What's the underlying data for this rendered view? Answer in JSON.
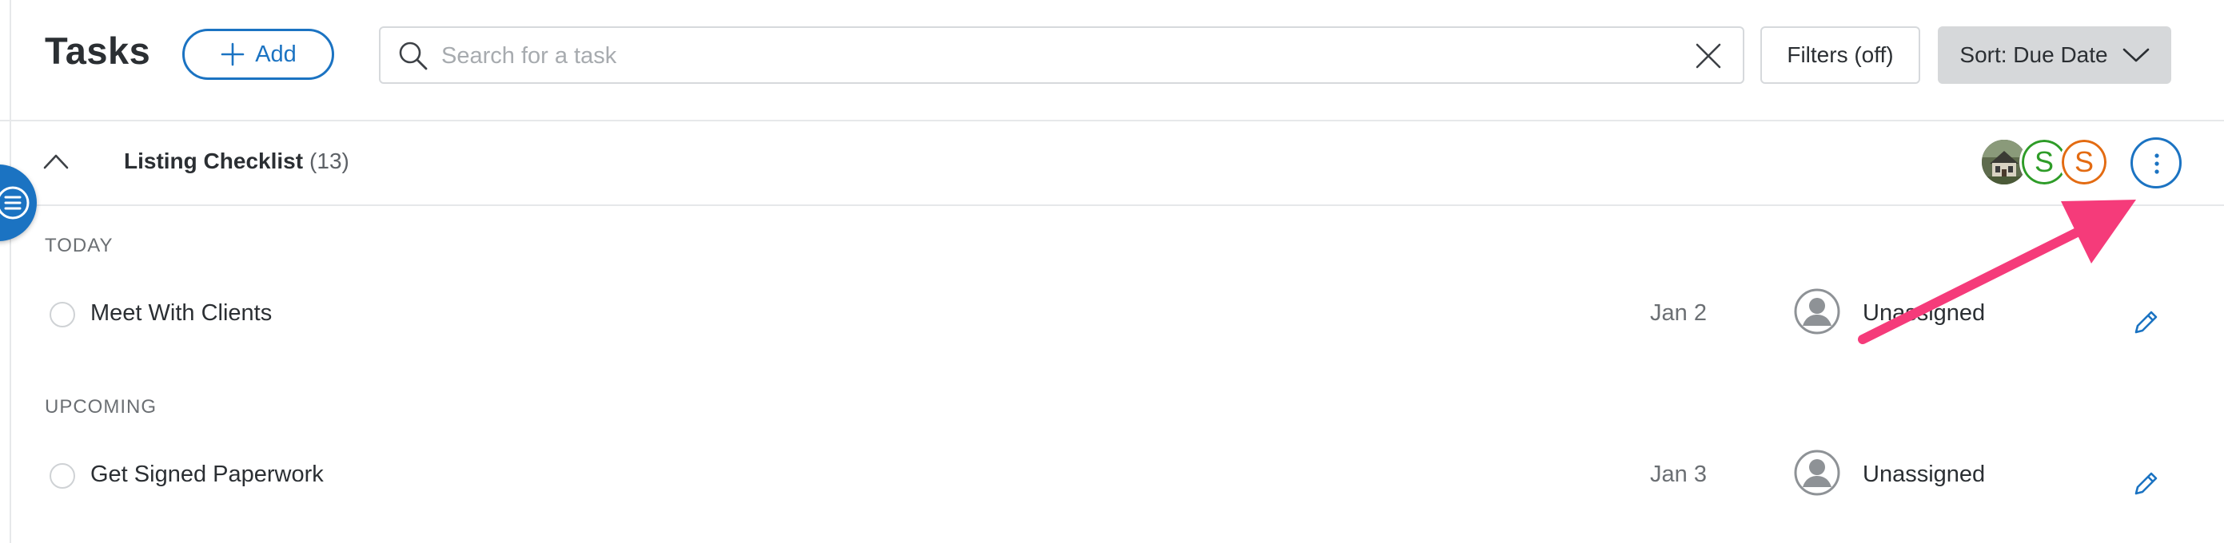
{
  "header": {
    "title": "Tasks",
    "add_label": "Add",
    "search": {
      "placeholder": "Search for a task",
      "value": ""
    },
    "filters_label": "Filters (off)",
    "sort_label": "Sort: Due Date"
  },
  "group": {
    "title": "Listing Checklist",
    "count": "(13)",
    "avatars": [
      {
        "type": "photo",
        "icon": "house-photo"
      },
      {
        "type": "initial",
        "letter": "S",
        "color": "#2e9c28"
      },
      {
        "type": "initial",
        "letter": "S",
        "color": "#e36b12"
      }
    ]
  },
  "sections": [
    {
      "label": "TODAY",
      "tasks": [
        {
          "name": "Meet With Clients",
          "date": "Jan 2",
          "assignee": "Unassigned"
        }
      ]
    },
    {
      "label": "UPCOMING",
      "tasks": [
        {
          "name": "Get Signed Paperwork",
          "date": "Jan 3",
          "assignee": "Unassigned"
        }
      ]
    }
  ],
  "colors": {
    "accent": "#1b73c2",
    "annotation_arrow": "#f53b7a"
  }
}
